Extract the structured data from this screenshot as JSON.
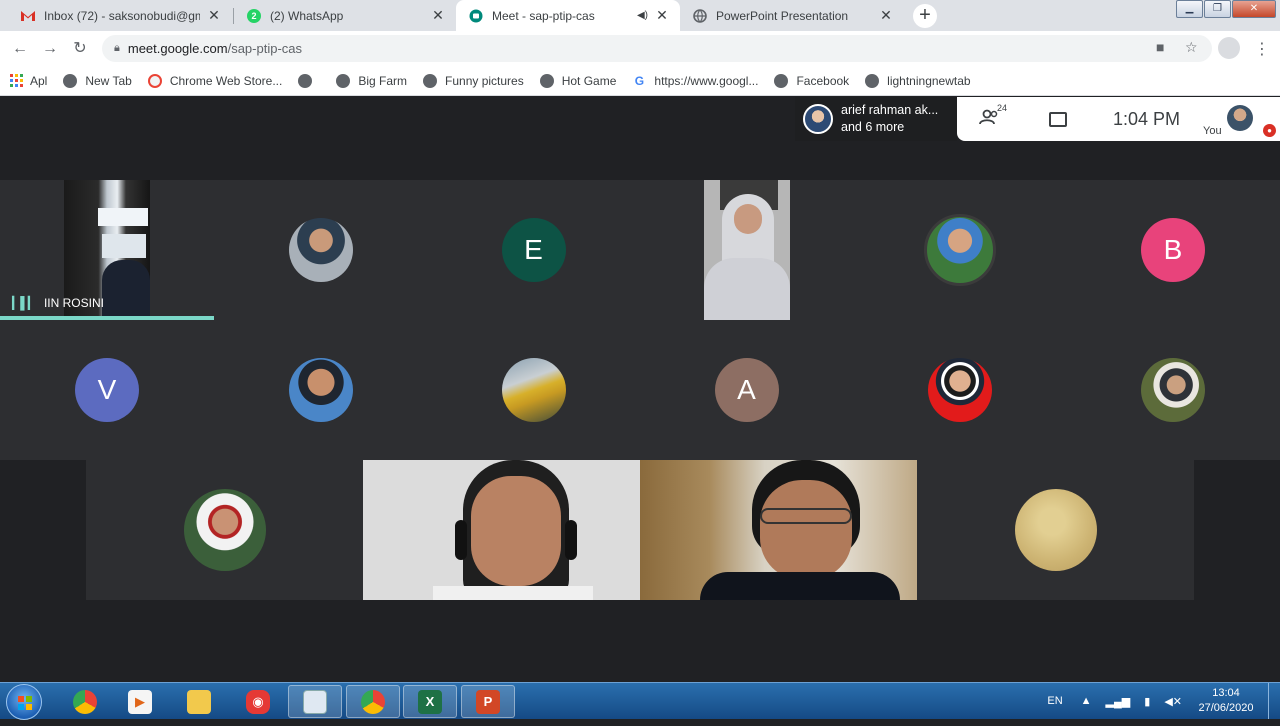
{
  "tabs": [
    {
      "title": "Inbox (72) - saksonobudi@gmail.",
      "icon": "gmail-icon",
      "active": false
    },
    {
      "title": "(2) WhatsApp",
      "icon": "whatsapp-icon",
      "active": false
    },
    {
      "title": "Meet - sap-ptip-cas",
      "icon": "meet-icon",
      "active": true
    },
    {
      "title": "PowerPoint Presentation",
      "icon": "globe-icon",
      "active": false
    }
  ],
  "address": {
    "host": "meet.google.com",
    "path": "/sap-ptip-cas"
  },
  "bookmarks": [
    {
      "label": "Apl",
      "icon": "apps-grid-icon"
    },
    {
      "label": "New Tab",
      "icon": "globe-icon"
    },
    {
      "label": "Chrome Web Store...",
      "icon": "webstore-icon"
    },
    {
      "label": "",
      "icon": "globe-icon"
    },
    {
      "label": "Big Farm",
      "icon": "globe-icon"
    },
    {
      "label": "Funny pictures",
      "icon": "globe-icon"
    },
    {
      "label": "Hot Game",
      "icon": "globe-icon"
    },
    {
      "label": "https://www.googl...",
      "icon": "google-icon"
    },
    {
      "label": "Facebook",
      "icon": "globe-icon"
    },
    {
      "label": "lightningnewtab",
      "icon": "globe-icon"
    }
  ],
  "meet": {
    "speaker_name": "arief rahman ak...",
    "speaker_more": "and 6 more",
    "people_count": "24",
    "clock": "1:04  PM",
    "you_label": "You",
    "active_participant": "IIN ROSINI",
    "letters": {
      "e": "E",
      "b": "B",
      "v": "V",
      "a": "A"
    },
    "colors": {
      "e": "#0d5345",
      "b": "#e8437b",
      "v": "#5c6bc0",
      "a": "#8d6e63"
    }
  },
  "taskbar": {
    "lang": "EN",
    "time": "13:04",
    "date": "27/06/2020"
  }
}
